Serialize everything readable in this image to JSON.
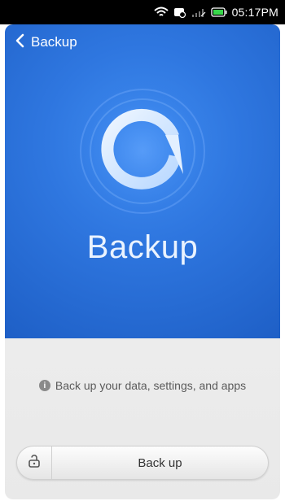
{
  "status_bar": {
    "time": "05:17PM",
    "icons": [
      "wifi-icon",
      "notification-icon",
      "signal-icon",
      "battery-icon"
    ]
  },
  "header": {
    "back_icon": "chevron-left-icon",
    "title": "Backup"
  },
  "hero": {
    "logo_icon": "backup-logo-icon",
    "app_name": "Backup"
  },
  "info": {
    "icon": "info-icon",
    "text": "Back up your data, settings, and apps"
  },
  "action_bar": {
    "lock_icon": "unlock-icon",
    "backup_label": "Back up"
  },
  "colors": {
    "hero_blue": "#2f77e0",
    "status_bar": "#000000",
    "battery_green": "#38d64a"
  }
}
